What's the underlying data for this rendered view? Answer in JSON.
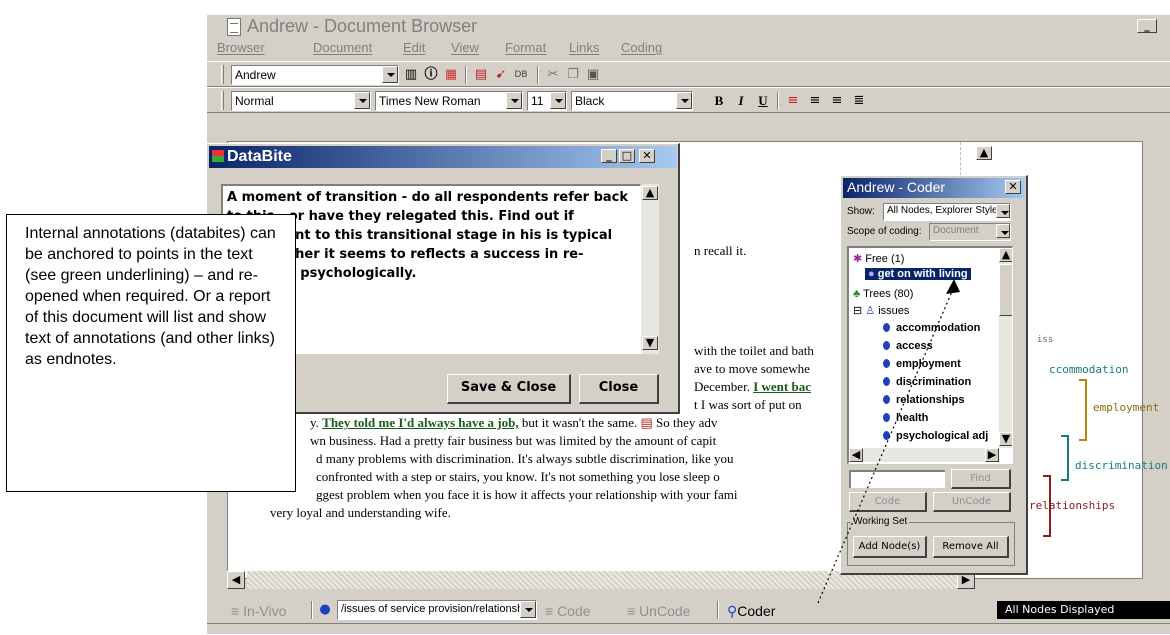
{
  "main": {
    "title": "Andrew - Document Browser",
    "menu": [
      "Browser",
      "Document",
      "Edit",
      "View",
      "Format",
      "Links",
      "Coding"
    ],
    "toolbar1": {
      "document_combo": "Andrew"
    },
    "toolbar2": {
      "style": "Normal",
      "font": "Times New Roman",
      "size": "11",
      "color": "Black"
    }
  },
  "document": {
    "lines": [
      "n recall it.",
      "with the toilet and bath",
      "ave to move somewhe",
      "December.",
      "t I was sort of put on",
      "business. Had a pretty fair business but was limited by the amount of capit",
      "d many problems with discrimination. It's always subtle discrimination, like you",
      "confronted with a step or stairs, you know. It's not something you lose sleep o",
      "ggest problem when you face it is how it affects your relationship with your fami",
      "very loyal and understanding wife."
    ],
    "link_went_back": "I went bac",
    "link_job": "They told me I'd always have a job,",
    "line_job_tail": " but it wasn't the same.",
    "line_job_tail2": " So they adv",
    "line_prefix_business": "wn",
    "line_prefix_y": "y."
  },
  "databite": {
    "title": "DataBite",
    "text": "A moment of transition - do all respondents refer back to this - or have they relegated this. Find out if adjustment to this transitional stage in his is typical and whether it seems to  reflects a success in re-adjusting psychologically.",
    "save_label": "Save & Close",
    "close_label": "Close"
  },
  "coder": {
    "title": "Andrew - Coder",
    "show_label": "Show:",
    "show_value": "All Nodes, Explorer Style",
    "scope_label": "Scope of coding:",
    "scope_value": "Document",
    "tree": {
      "free": "Free (1)",
      "free_child": "get on with living",
      "trees": "Trees (80)",
      "issues": "issues",
      "children": [
        "accommodation",
        "access",
        "employment",
        "discrimination",
        "relationships",
        "health",
        "psychological adj"
      ]
    },
    "find_label": "Find",
    "code_label": "Code",
    "uncode_label": "UnCode",
    "working_set_label": "Working Set",
    "add_node_label": "Add Node(s)",
    "remove_all_label": "Remove All"
  },
  "bottom": {
    "invivo_label": "In-Vivo",
    "node_path": "/issues of service provision/relationship wit",
    "code_label": "Code",
    "uncode_label": "UnCode",
    "coder_label": "Coder",
    "nodes_displayed": "All Nodes Displayed"
  },
  "diagram": {
    "label_iss": "iss",
    "label_accommodation": "ccommodation",
    "label_employment": "employment",
    "label_discrimination": "discrimination, a",
    "label_relationships": "relationships"
  },
  "callout": {
    "text": "Internal annotations (databites) can be anchored to points in the text (see green underlining) – and re-opened when required. Or a report of this document will list  and show text of annotations (and other links) as endnotes."
  },
  "colors": {
    "titlebar_active": "#0a246a",
    "link_green": "#1a5c1a",
    "bracket_gold": "#b8860b",
    "bracket_teal": "#1a7a7a",
    "bracket_red": "#8b1a1a"
  }
}
